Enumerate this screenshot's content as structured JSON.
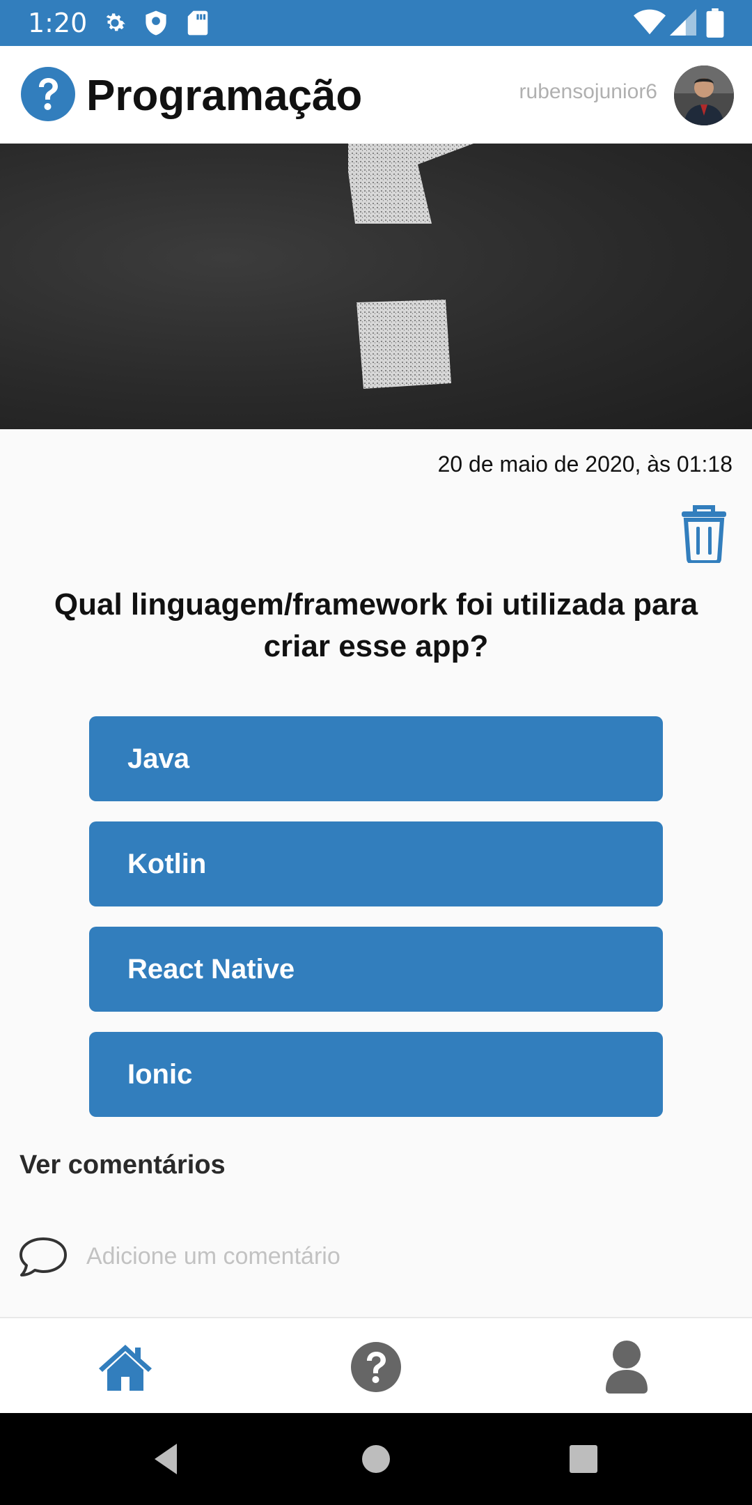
{
  "status_bar": {
    "time": "1:20",
    "icons": [
      "gear-icon",
      "shield-icon",
      "sd-card-icon",
      "wifi-icon",
      "signal-icon",
      "battery-icon"
    ],
    "background": "#327ebd"
  },
  "header": {
    "title": "Programação",
    "username": "rubensojunior6",
    "logo_icon": "question-circle-icon"
  },
  "post": {
    "date": "20 de maio de 2020, às 01:18",
    "question": "Qual linguagem/framework foi utilizada para criar esse app?",
    "options": [
      "Java",
      "Kotlin",
      "React Native",
      "Ionic"
    ]
  },
  "comments": {
    "see_label": "Ver comentários",
    "placeholder": "Adicione um comentário"
  },
  "bottom_nav": {
    "items": [
      "home-icon",
      "question-icon",
      "user-icon"
    ],
    "active": "home-icon"
  },
  "colors": {
    "accent": "#327ebd",
    "inactive_nav": "#666666"
  }
}
